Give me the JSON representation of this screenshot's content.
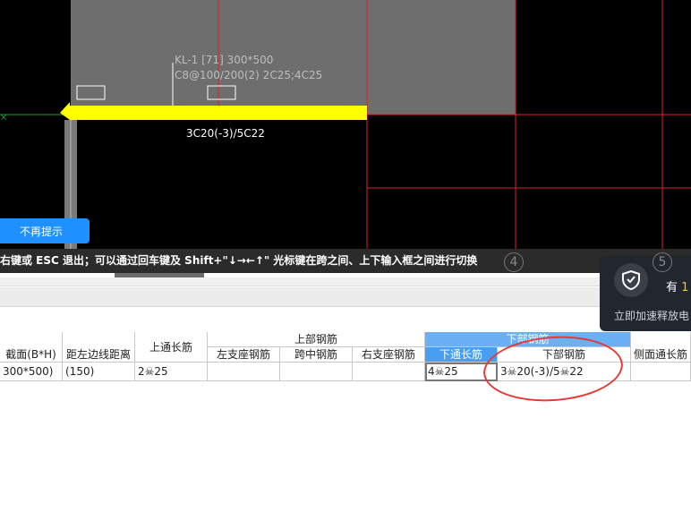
{
  "cad": {
    "beam_name": "KL-1 [71] 300*500",
    "beam_stirrup": "C8@100/200(2) 2C25;4C25",
    "bottom_label": "3C20(-3)/5C22",
    "no_remind_button": "不再提示",
    "hint_text": "右键或 ESC 退出；可以通过回车键及 Shift+\"↓→←↑\" 光标键在跨之间、上下输入框之间进行切换",
    "axis_numbers": [
      "4",
      "5"
    ],
    "colors": {
      "beam_fill": "#6e6e6e",
      "grid_line": "#e0202a",
      "highlight_beam": "#ffff00"
    }
  },
  "popup": {
    "title_prefix": "有",
    "title_highlight": "1",
    "subtitle": "立即加速释放电",
    "icon": "shield-check-icon"
  },
  "table": {
    "headers": {
      "section": "截面(B*H)",
      "edge_distance": "距左边线距离",
      "top_through": "上通长筋",
      "top_rebar_group": "上部钢筋",
      "left_support": "左支座钢筋",
      "mid_span": "跨中钢筋",
      "right_support": "右支座钢筋",
      "bottom_rebar_group": "下部钢筋",
      "bottom_through": "下通长筋",
      "bottom_rebar": "下部钢筋",
      "side_through": "侧面通长筋"
    },
    "row": {
      "section": "300*500)",
      "edge_distance": "(150)",
      "top_through": "2☠25",
      "left_support": "",
      "mid_span": "",
      "right_support": "",
      "bottom_through": "4☠25",
      "bottom_rebar": "3☠20(-3)/5☠22",
      "side_through": ""
    }
  }
}
